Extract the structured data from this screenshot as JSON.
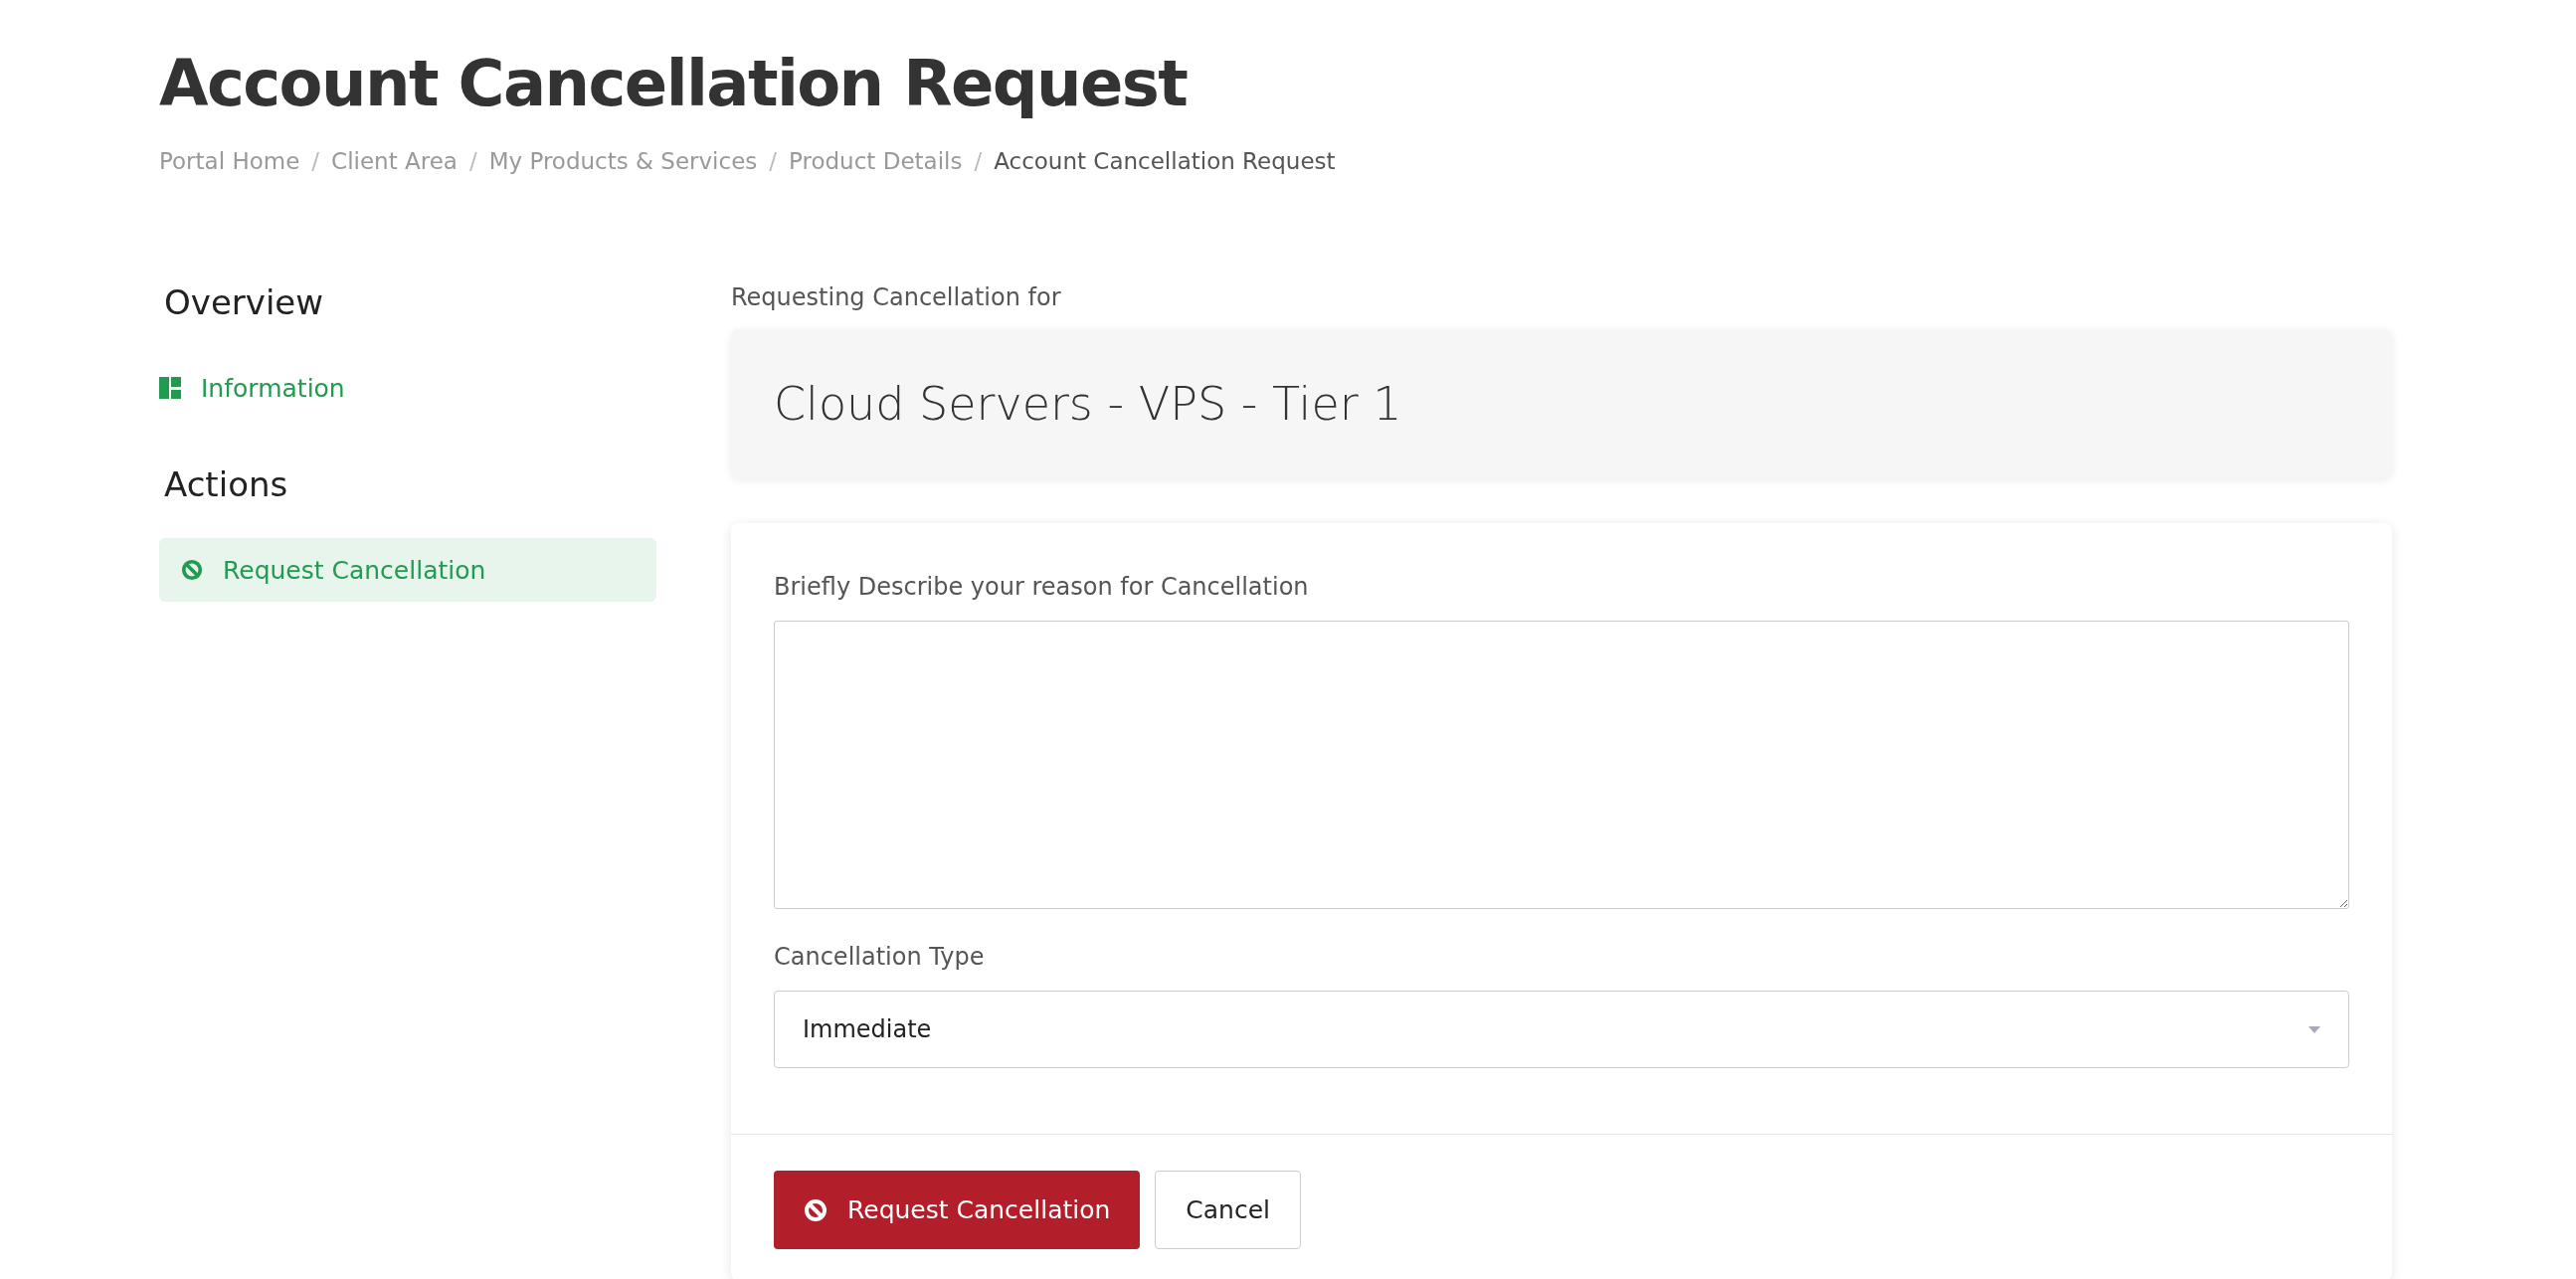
{
  "page": {
    "title": "Account Cancellation Request"
  },
  "breadcrumb_separator": "/",
  "breadcrumb": [
    {
      "label": "Portal Home",
      "selected": false
    },
    {
      "label": "Client Area",
      "selected": false
    },
    {
      "label": "My Products & Services",
      "selected": false
    },
    {
      "label": "Product Details",
      "selected": false
    },
    {
      "label": "Account Cancellation Request",
      "selected": true
    }
  ],
  "sidebar": [
    {
      "heading": "Overview",
      "items": [
        {
          "label": "Information",
          "kind": "info",
          "selected": false
        }
      ]
    },
    {
      "heading": "Actions",
      "items": [
        {
          "label": "Request Cancellation",
          "kind": "cancel",
          "selected": true
        }
      ]
    }
  ],
  "product": {
    "caption": "Requesting Cancellation for",
    "name": "Cloud Servers - VPS - Tier 1"
  },
  "form": {
    "reason_label": "Briefly Describe your reason for Cancellation",
    "type_label": "Cancellation Type",
    "type_value": "Immediate"
  },
  "buttons": [
    {
      "label": "Request Cancellation",
      "kind": "primary"
    },
    {
      "label": "Cancel",
      "kind": "secondary"
    }
  ]
}
